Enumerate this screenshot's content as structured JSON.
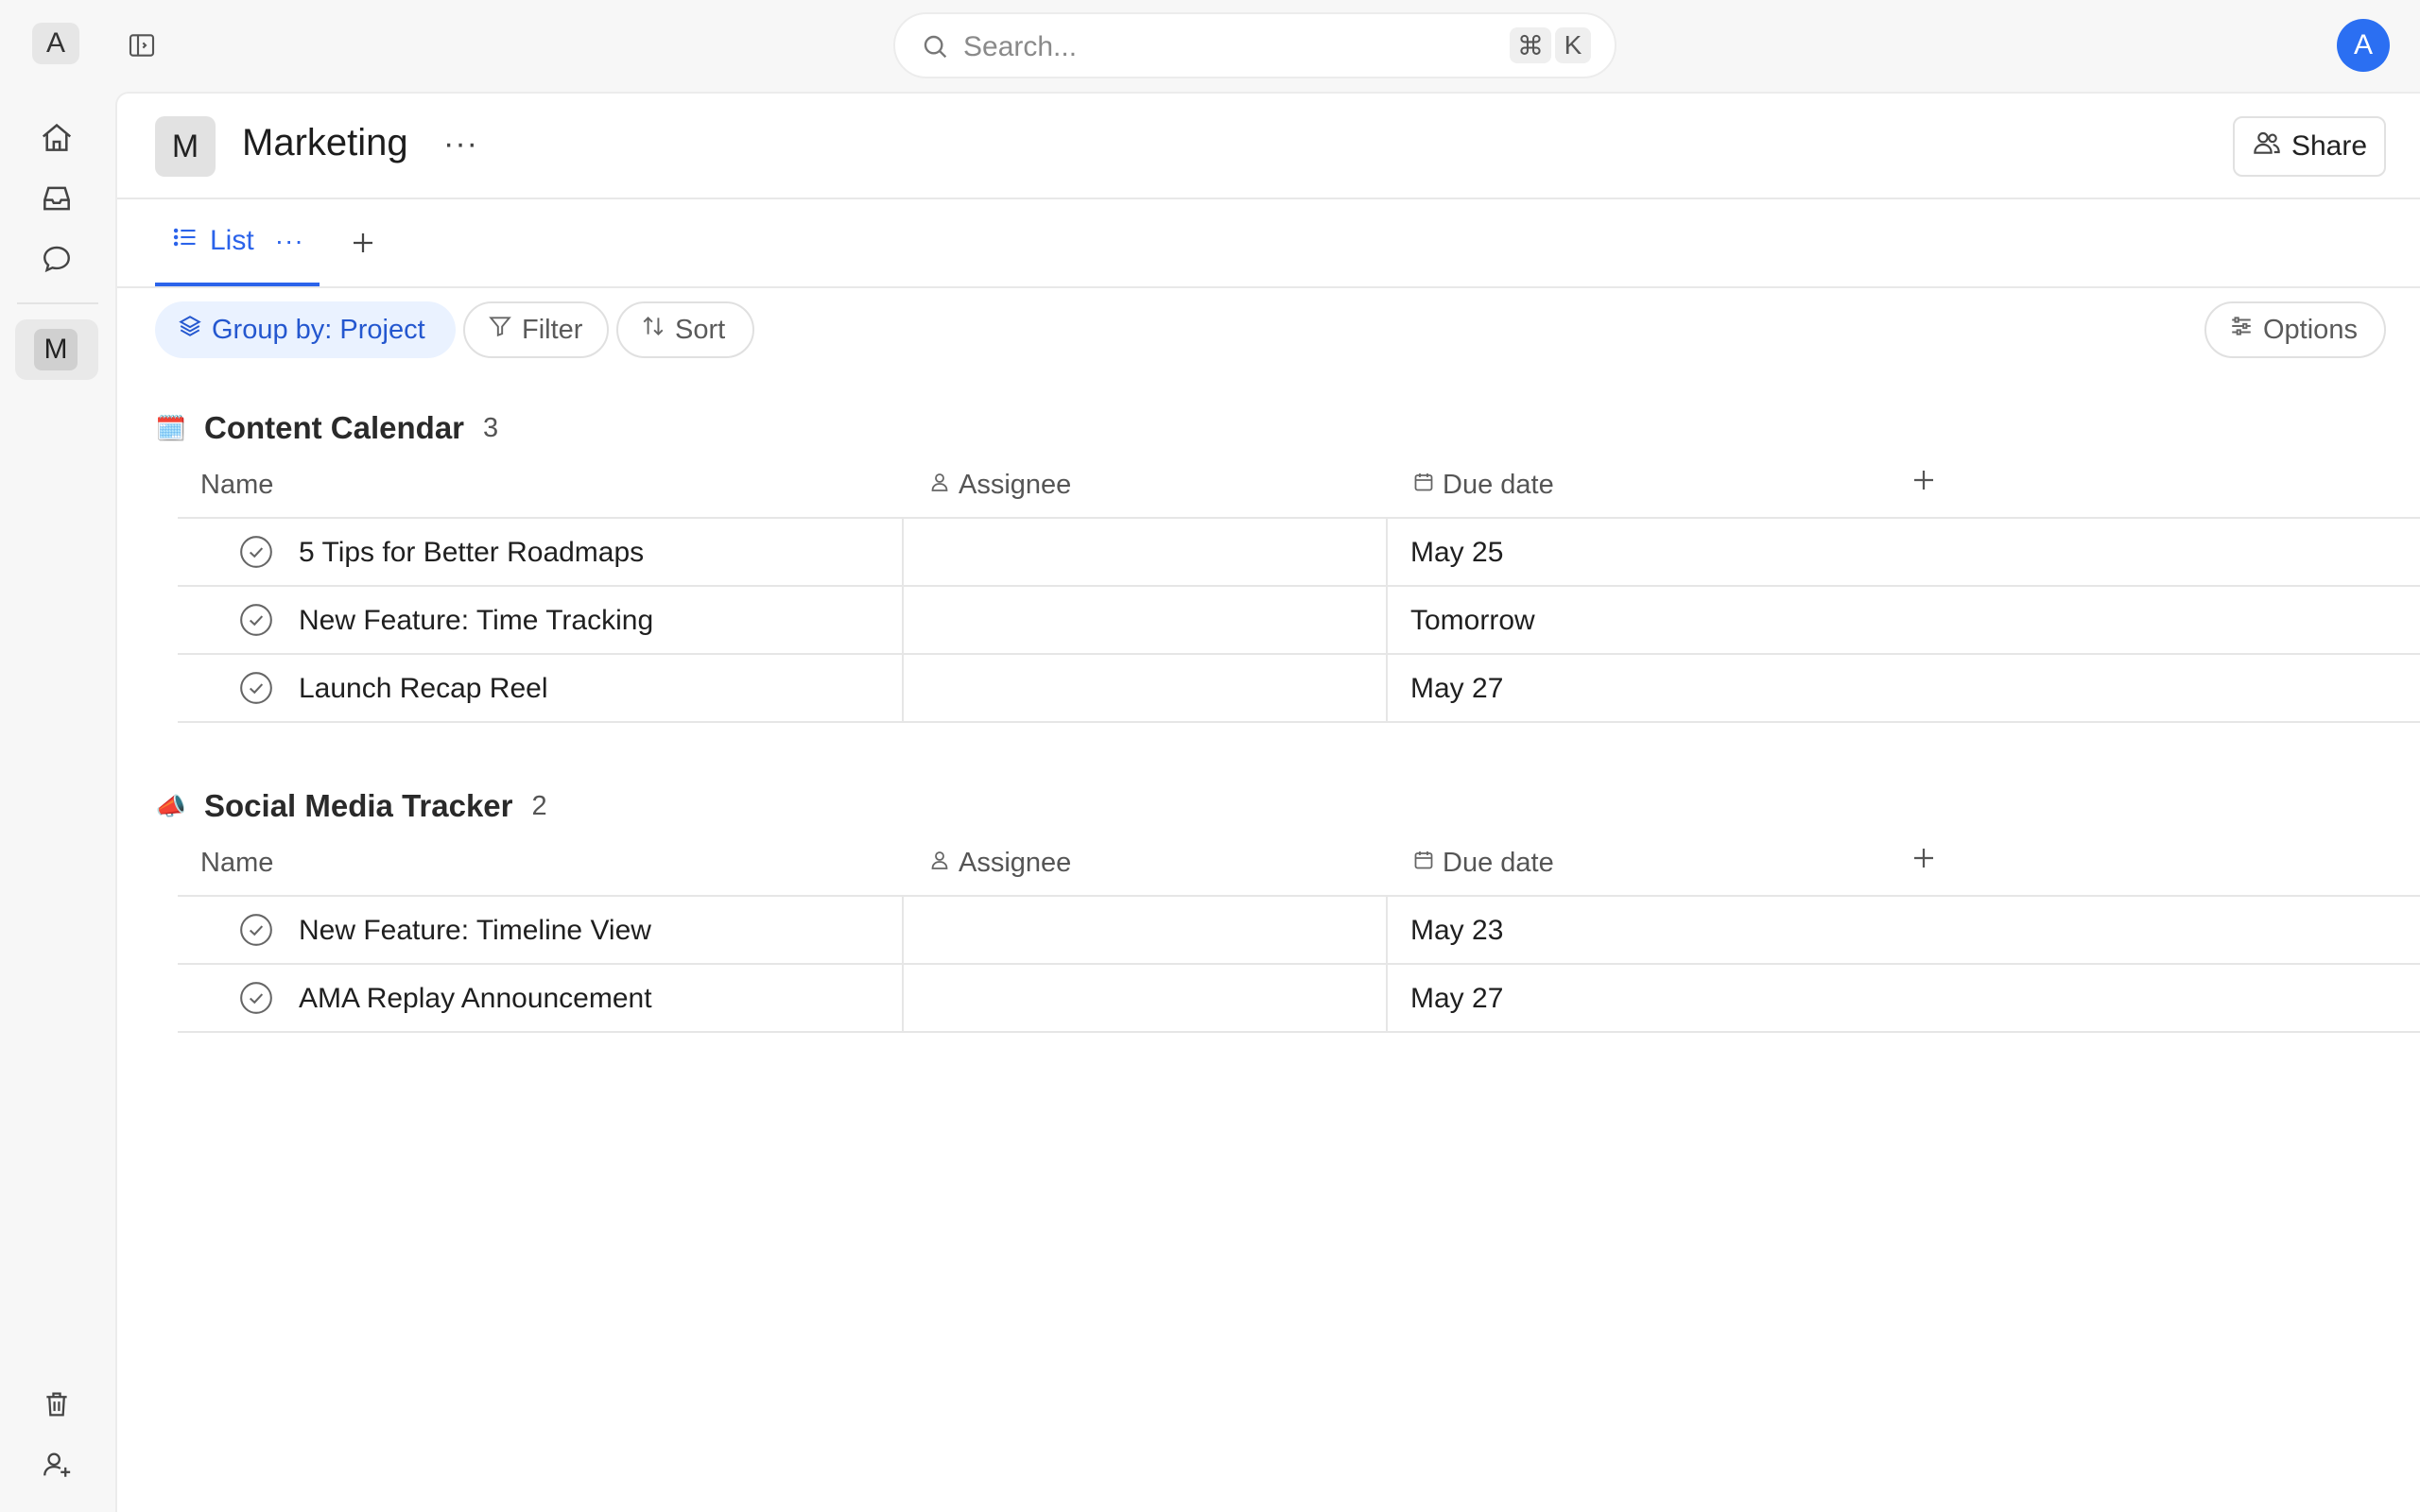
{
  "workspace": {
    "initial": "A"
  },
  "search": {
    "placeholder": "Search...",
    "shortcut_mod": "⌘",
    "shortcut_key": "K"
  },
  "user": {
    "avatar_initial": "A",
    "avatar_color": "#2b6ff2"
  },
  "sidebar": {
    "project_initial": "M"
  },
  "project": {
    "initial": "M",
    "title": "Marketing",
    "more": "···",
    "share_label": "Share"
  },
  "tabs": {
    "active_label": "List",
    "active_more": "···"
  },
  "toolbar": {
    "group_label": "Group by: Project",
    "filter_label": "Filter",
    "sort_label": "Sort",
    "options_label": "Options"
  },
  "columns": {
    "name": "Name",
    "assignee": "Assignee",
    "due": "Due date"
  },
  "groups": [
    {
      "emoji": "🗓️",
      "title": "Content Calendar",
      "count": "3",
      "tasks": [
        {
          "name": "5 Tips for Better Roadmaps",
          "assignee": "",
          "due": "May 25"
        },
        {
          "name": "New Feature: Time Tracking",
          "assignee": "",
          "due": "Tomorrow"
        },
        {
          "name": "Launch Recap Reel",
          "assignee": "",
          "due": "May 27"
        }
      ]
    },
    {
      "emoji": "📣",
      "title": "Social Media Tracker",
      "count": "2",
      "tasks": [
        {
          "name": "New Feature: Timeline View",
          "assignee": "",
          "due": "May 23"
        },
        {
          "name": "AMA Replay Announcement",
          "assignee": "",
          "due": "May 27"
        }
      ]
    }
  ],
  "colors": {
    "accent": "#2b63ea",
    "chip_bg": "#eaf2ff"
  }
}
